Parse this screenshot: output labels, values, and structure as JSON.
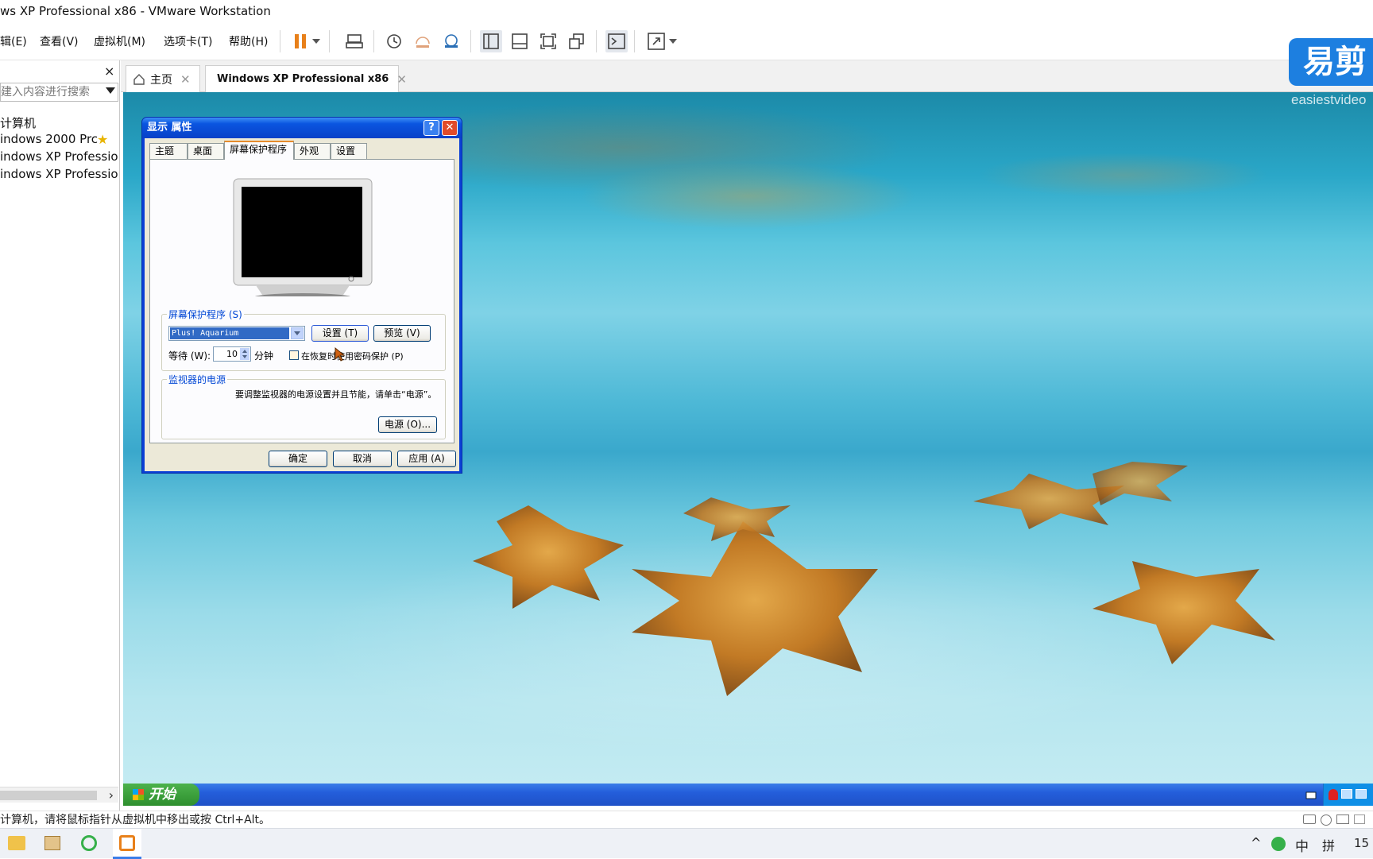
{
  "window": {
    "title": "ws XP Professional x86 - VMware Workstation"
  },
  "menu": [
    "辑(E)",
    "查看(V)",
    "虚拟机(M)",
    "选项卡(T)",
    "帮助(H)"
  ],
  "toolbar_icons": [
    "pause-icon",
    "dropdown-icon",
    "send-keys-icon",
    "snapshot-icon",
    "revert-snapshot-icon",
    "snapshot-manager-icon",
    "library-view-icon",
    "thumbnail-view-icon",
    "fullscreen-icon",
    "unity-icon",
    "console-icon",
    "stretch-icon"
  ],
  "sidebar": {
    "close": "×",
    "search_placeholder": "建入内容进行搜索",
    "items": [
      {
        "label": "计算机"
      },
      {
        "label": "indows 2000 Prc"
      },
      {
        "label": "indows XP Professior"
      },
      {
        "label": "indows XP Professior"
      }
    ]
  },
  "tabs": [
    {
      "label": "主页"
    },
    {
      "label": "Windows XP Professional x86"
    }
  ],
  "watermark": {
    "logo": "易剪",
    "sub": "easiestvideo"
  },
  "dialog": {
    "title": "显示 属性",
    "help": "?",
    "close": "✕",
    "tabs": [
      "主题",
      "桌面",
      "屏幕保护程序",
      "外观",
      "设置"
    ],
    "selected_tab": "屏幕保护程序",
    "screensaver_group": "屏幕保护程序 (S)",
    "screensaver_value": "Plus! Aquarium",
    "settings_button": "设置 (T)",
    "preview_button": "预览 (V)",
    "wait_label": "等待 (W):",
    "wait_value": "10",
    "wait_unit": "分钟",
    "password_checkbox": "在恢复时使用密码保护 (P)",
    "power_group": "监视器的电源",
    "power_text": "要调整监视器的电源设置并且节能，请单击“电源”。",
    "power_button": "电源 (O)...",
    "ok": "确定",
    "cancel": "取消",
    "apply": "应用 (A)"
  },
  "xp_taskbar": {
    "start": "开始"
  },
  "status": {
    "text": "计算机，请将鼠标指针从虚拟机中移出或按 Ctrl+Alt。"
  },
  "host_taskbar": {
    "ime_lang": "中",
    "ime_mode": "拼",
    "clock": "15"
  }
}
